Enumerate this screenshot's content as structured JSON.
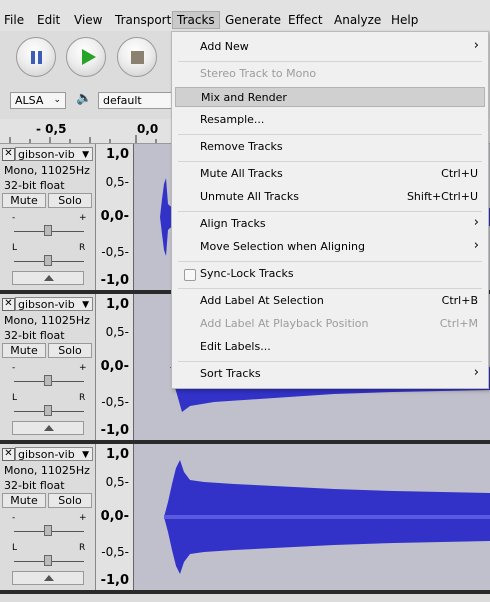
{
  "menubar": {
    "items": [
      "File",
      "Edit",
      "View",
      "Transport",
      "Tracks",
      "Generate",
      "Effect",
      "Analyze",
      "Help"
    ]
  },
  "toolbar": {
    "host_label": "ALSA",
    "device_label": "default"
  },
  "ruler": {
    "labels": [
      "- 0,5",
      "0,0"
    ]
  },
  "tracks": [
    {
      "name": "gibson-vib",
      "info1": "Mono, 11025Hz",
      "info2": "32-bit float",
      "mute": "Mute",
      "solo": "Solo",
      "gain_minus": "-",
      "gain_plus": "+",
      "pan_left": "L",
      "pan_right": "R",
      "scale": [
        "1,0",
        "0,5-",
        "0,0-",
        "-0,5-",
        "-1,0"
      ]
    },
    {
      "name": "gibson-vib",
      "info1": "Mono, 11025Hz",
      "info2": "32-bit float",
      "mute": "Mute",
      "solo": "Solo",
      "gain_minus": "-",
      "gain_plus": "+",
      "pan_left": "L",
      "pan_right": "R",
      "scale": [
        "1,0",
        "0,5-",
        "0,0-",
        "-0,5-",
        "-1,0"
      ]
    },
    {
      "name": "gibson-vib",
      "info1": "Mono, 11025Hz",
      "info2": "32-bit float",
      "mute": "Mute",
      "solo": "Solo",
      "gain_minus": "-",
      "gain_plus": "+",
      "pan_left": "L",
      "pan_right": "R",
      "scale": [
        "1,0",
        "0,5-",
        "0,0-",
        "-0,5-",
        "-1,0"
      ]
    }
  ],
  "tracks_menu": {
    "items": [
      {
        "label": "Add New",
        "shortcut": "",
        "submenu": true,
        "disabled": false
      },
      {
        "label": "Stereo Track to Mono",
        "shortcut": "",
        "submenu": false,
        "disabled": true
      },
      {
        "label": "Mix and Render",
        "shortcut": "",
        "submenu": false,
        "disabled": false,
        "highlighted": true
      },
      {
        "label": "Resample...",
        "shortcut": "",
        "submenu": false,
        "disabled": false
      },
      {
        "label": "Remove Tracks",
        "shortcut": "",
        "submenu": false,
        "disabled": false
      },
      {
        "label": "Mute All Tracks",
        "shortcut": "Ctrl+U",
        "submenu": false,
        "disabled": false
      },
      {
        "label": "Unmute All Tracks",
        "shortcut": "Shift+Ctrl+U",
        "submenu": false,
        "disabled": false
      },
      {
        "label": "Align Tracks",
        "shortcut": "",
        "submenu": true,
        "disabled": false
      },
      {
        "label": "Move Selection when Aligning",
        "shortcut": "",
        "submenu": true,
        "disabled": false
      },
      {
        "label": "Sync-Lock Tracks",
        "shortcut": "",
        "submenu": false,
        "disabled": false,
        "checkbox": true
      },
      {
        "label": "Add Label At Selection",
        "shortcut": "Ctrl+B",
        "submenu": false,
        "disabled": false
      },
      {
        "label": "Add Label At Playback Position",
        "shortcut": "Ctrl+M",
        "submenu": false,
        "disabled": true
      },
      {
        "label": "Edit Labels...",
        "shortcut": "",
        "submenu": false,
        "disabled": false
      },
      {
        "label": "Sort Tracks",
        "shortcut": "",
        "submenu": true,
        "disabled": false
      }
    ]
  },
  "colors": {
    "waveform": "#3232c8",
    "track_background": "#c0c0cc",
    "menu_background": "#f0f0f0",
    "pause_icon": "#3b5db8",
    "play_icon": "#27a327",
    "stop_icon": "#8c8170"
  }
}
